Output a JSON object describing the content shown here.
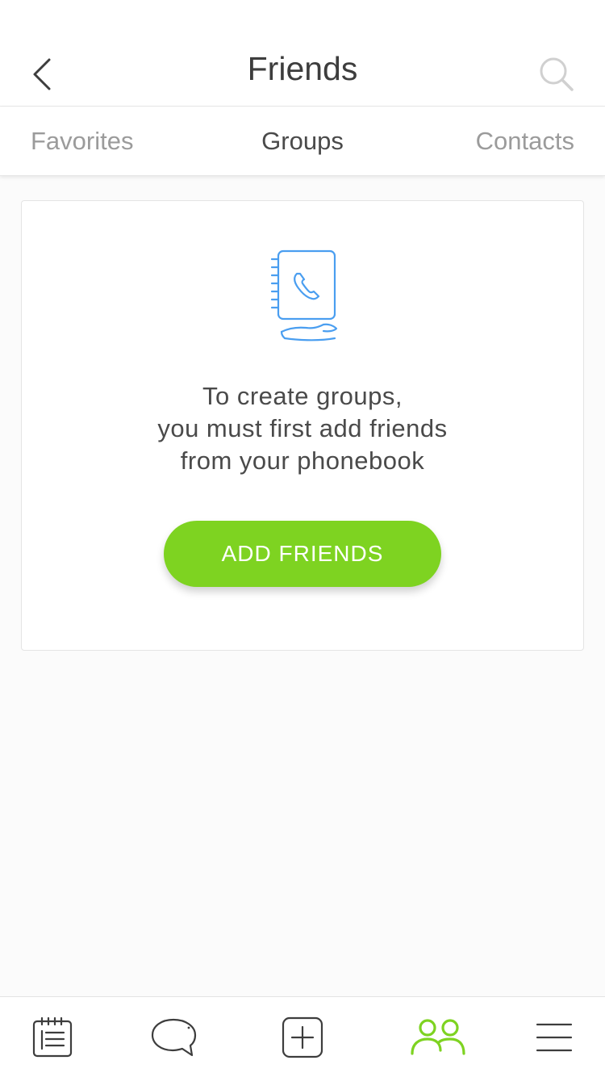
{
  "header": {
    "title": "Friends",
    "back_icon": "chevron-left-icon",
    "search_icon": "search-icon"
  },
  "tabs": [
    {
      "label": "Favorites",
      "active": false
    },
    {
      "label": "Groups",
      "active": true
    },
    {
      "label": "Contacts",
      "active": false
    }
  ],
  "empty_state": {
    "icon": "phonebook-icon",
    "lines": [
      "To create groups,",
      "you must first add friends",
      "from your phonebook"
    ],
    "button_label": "ADD FRIENDS"
  },
  "bottom_nav": [
    {
      "icon": "notepad-icon",
      "active": false
    },
    {
      "icon": "chat-bubble-icon",
      "active": false
    },
    {
      "icon": "plus-square-icon",
      "active": false
    },
    {
      "icon": "friends-icon",
      "active": true
    },
    {
      "icon": "menu-icon",
      "active": false
    }
  ],
  "colors": {
    "accent": "#7ed321",
    "icon_blue": "#4a9ef0",
    "text": "#4a4a4a",
    "inactive_tab": "#9b9b9b"
  }
}
